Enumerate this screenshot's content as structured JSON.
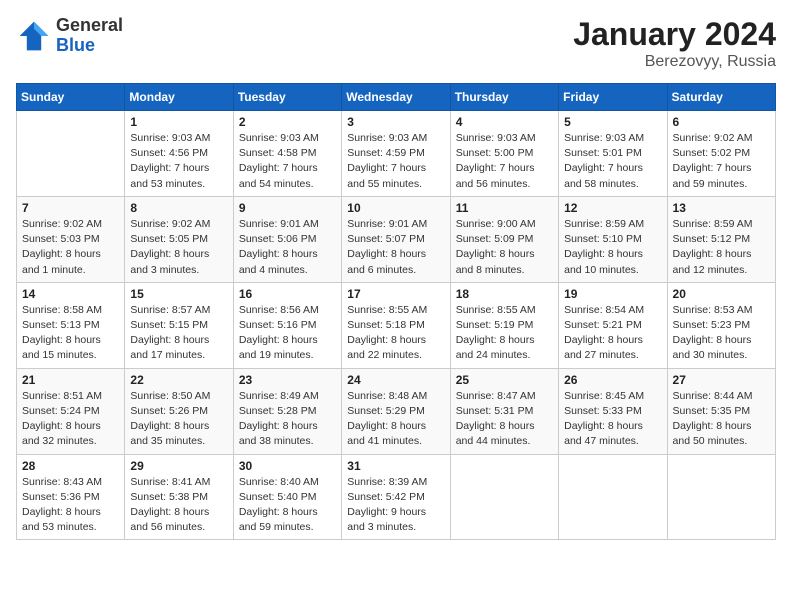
{
  "header": {
    "logo_general": "General",
    "logo_blue": "Blue",
    "month_title": "January 2024",
    "location": "Berezovyy, Russia"
  },
  "weekdays": [
    "Sunday",
    "Monday",
    "Tuesday",
    "Wednesday",
    "Thursday",
    "Friday",
    "Saturday"
  ],
  "weeks": [
    [
      null,
      {
        "day": 1,
        "sunrise": "9:03 AM",
        "sunset": "4:56 PM",
        "daylight": "7 hours and 53 minutes."
      },
      {
        "day": 2,
        "sunrise": "9:03 AM",
        "sunset": "4:58 PM",
        "daylight": "7 hours and 54 minutes."
      },
      {
        "day": 3,
        "sunrise": "9:03 AM",
        "sunset": "4:59 PM",
        "daylight": "7 hours and 55 minutes."
      },
      {
        "day": 4,
        "sunrise": "9:03 AM",
        "sunset": "5:00 PM",
        "daylight": "7 hours and 56 minutes."
      },
      {
        "day": 5,
        "sunrise": "9:03 AM",
        "sunset": "5:01 PM",
        "daylight": "7 hours and 58 minutes."
      },
      {
        "day": 6,
        "sunrise": "9:02 AM",
        "sunset": "5:02 PM",
        "daylight": "7 hours and 59 minutes."
      }
    ],
    [
      {
        "day": 7,
        "sunrise": "9:02 AM",
        "sunset": "5:03 PM",
        "daylight": "8 hours and 1 minute."
      },
      {
        "day": 8,
        "sunrise": "9:02 AM",
        "sunset": "5:05 PM",
        "daylight": "8 hours and 3 minutes."
      },
      {
        "day": 9,
        "sunrise": "9:01 AM",
        "sunset": "5:06 PM",
        "daylight": "8 hours and 4 minutes."
      },
      {
        "day": 10,
        "sunrise": "9:01 AM",
        "sunset": "5:07 PM",
        "daylight": "8 hours and 6 minutes."
      },
      {
        "day": 11,
        "sunrise": "9:00 AM",
        "sunset": "5:09 PM",
        "daylight": "8 hours and 8 minutes."
      },
      {
        "day": 12,
        "sunrise": "8:59 AM",
        "sunset": "5:10 PM",
        "daylight": "8 hours and 10 minutes."
      },
      {
        "day": 13,
        "sunrise": "8:59 AM",
        "sunset": "5:12 PM",
        "daylight": "8 hours and 12 minutes."
      }
    ],
    [
      {
        "day": 14,
        "sunrise": "8:58 AM",
        "sunset": "5:13 PM",
        "daylight": "8 hours and 15 minutes."
      },
      {
        "day": 15,
        "sunrise": "8:57 AM",
        "sunset": "5:15 PM",
        "daylight": "8 hours and 17 minutes."
      },
      {
        "day": 16,
        "sunrise": "8:56 AM",
        "sunset": "5:16 PM",
        "daylight": "8 hours and 19 minutes."
      },
      {
        "day": 17,
        "sunrise": "8:55 AM",
        "sunset": "5:18 PM",
        "daylight": "8 hours and 22 minutes."
      },
      {
        "day": 18,
        "sunrise": "8:55 AM",
        "sunset": "5:19 PM",
        "daylight": "8 hours and 24 minutes."
      },
      {
        "day": 19,
        "sunrise": "8:54 AM",
        "sunset": "5:21 PM",
        "daylight": "8 hours and 27 minutes."
      },
      {
        "day": 20,
        "sunrise": "8:53 AM",
        "sunset": "5:23 PM",
        "daylight": "8 hours and 30 minutes."
      }
    ],
    [
      {
        "day": 21,
        "sunrise": "8:51 AM",
        "sunset": "5:24 PM",
        "daylight": "8 hours and 32 minutes."
      },
      {
        "day": 22,
        "sunrise": "8:50 AM",
        "sunset": "5:26 PM",
        "daylight": "8 hours and 35 minutes."
      },
      {
        "day": 23,
        "sunrise": "8:49 AM",
        "sunset": "5:28 PM",
        "daylight": "8 hours and 38 minutes."
      },
      {
        "day": 24,
        "sunrise": "8:48 AM",
        "sunset": "5:29 PM",
        "daylight": "8 hours and 41 minutes."
      },
      {
        "day": 25,
        "sunrise": "8:47 AM",
        "sunset": "5:31 PM",
        "daylight": "8 hours and 44 minutes."
      },
      {
        "day": 26,
        "sunrise": "8:45 AM",
        "sunset": "5:33 PM",
        "daylight": "8 hours and 47 minutes."
      },
      {
        "day": 27,
        "sunrise": "8:44 AM",
        "sunset": "5:35 PM",
        "daylight": "8 hours and 50 minutes."
      }
    ],
    [
      {
        "day": 28,
        "sunrise": "8:43 AM",
        "sunset": "5:36 PM",
        "daylight": "8 hours and 53 minutes."
      },
      {
        "day": 29,
        "sunrise": "8:41 AM",
        "sunset": "5:38 PM",
        "daylight": "8 hours and 56 minutes."
      },
      {
        "day": 30,
        "sunrise": "8:40 AM",
        "sunset": "5:40 PM",
        "daylight": "8 hours and 59 minutes."
      },
      {
        "day": 31,
        "sunrise": "8:39 AM",
        "sunset": "5:42 PM",
        "daylight": "9 hours and 3 minutes."
      },
      null,
      null,
      null
    ]
  ],
  "labels": {
    "sunrise_prefix": "Sunrise: ",
    "sunset_prefix": "Sunset: ",
    "daylight_prefix": "Daylight: "
  }
}
